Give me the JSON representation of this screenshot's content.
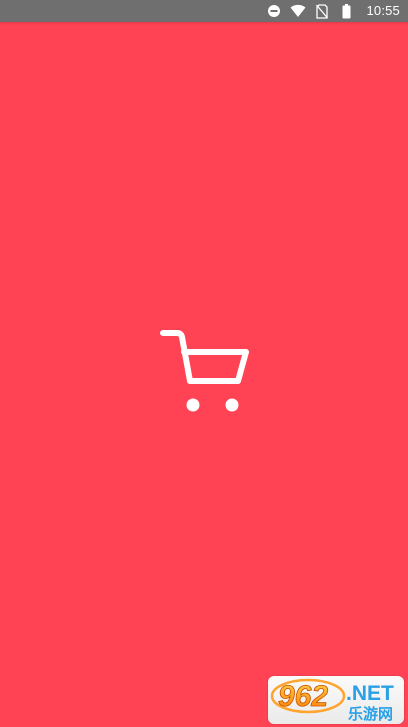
{
  "status_bar": {
    "time": "10:55",
    "icons": [
      "do-not-disturb-icon",
      "wifi-icon",
      "no-sim-icon",
      "battery-icon"
    ]
  },
  "splash": {
    "background_color": "#FF4254",
    "icon": "shopping-cart-icon",
    "icon_color": "#FFFFFF"
  },
  "watermark": {
    "logo": "962-net-logo",
    "brand_number": "962",
    "brand_suffix": ".NET",
    "brand_cn": "乐游网"
  }
}
